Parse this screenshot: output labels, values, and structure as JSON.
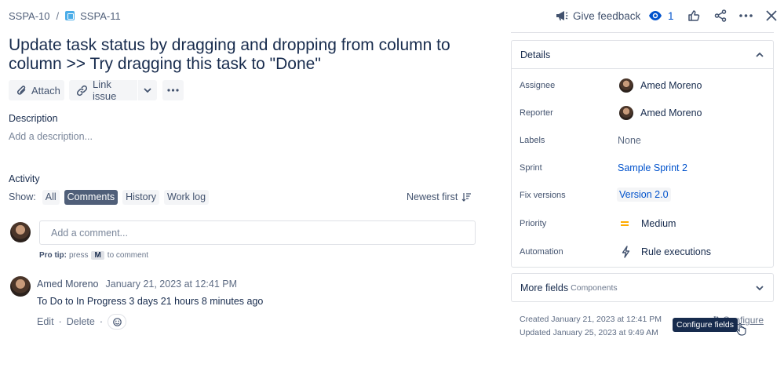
{
  "breadcrumb": {
    "parent": "SSPA-10",
    "separator": "/",
    "current": "SSPA-11"
  },
  "header": {
    "feedback_label": "Give feedback",
    "watchers": "1"
  },
  "title": "Update task status by dragging and dropping from column to column >> Try dragging this task to \"Done\"",
  "actions": {
    "attach": "Attach",
    "link_issue": "Link issue"
  },
  "description": {
    "label": "Description",
    "placeholder": "Add a description..."
  },
  "activity": {
    "label": "Activity",
    "show_label": "Show:",
    "filters": [
      "All",
      "Comments",
      "History",
      "Work log"
    ],
    "active_filter": "Comments",
    "sort_label": "Newest first"
  },
  "comment_input": {
    "placeholder": "Add a comment...",
    "pro_tip_label": "Pro tip:",
    "pro_tip_pre": "press",
    "pro_tip_key": "M",
    "pro_tip_post": "to comment"
  },
  "history_entry": {
    "author": "Amed Moreno",
    "timestamp": "January 21, 2023 at 12:41 PM",
    "text": "To Do to In Progress 3 days 21 hours 8 minutes ago",
    "edit": "Edit",
    "dot": "·",
    "delete": "Delete"
  },
  "details": {
    "title": "Details",
    "fields": [
      {
        "label": "Assignee",
        "value": "Amed Moreno"
      },
      {
        "label": "Reporter",
        "value": "Amed Moreno"
      },
      {
        "label": "Labels",
        "value": "None"
      },
      {
        "label": "Sprint",
        "value": "Sample Sprint 2"
      },
      {
        "label": "Fix versions",
        "value": "Version 2.0"
      },
      {
        "label": "Priority",
        "value": "Medium"
      },
      {
        "label": "Automation",
        "value": "Rule executions"
      }
    ]
  },
  "more_fields": {
    "title": "More fields",
    "hint": "Components"
  },
  "footer": {
    "created": "Created January 21, 2023 at 12:41 PM",
    "updated": "Updated January 25, 2023 at 9:49 AM",
    "configure": "Configure",
    "tooltip": "Configure fields"
  },
  "colors": {
    "accent": "#0052cc",
    "active_chip": "#505f79",
    "priority": "#ffab00"
  }
}
